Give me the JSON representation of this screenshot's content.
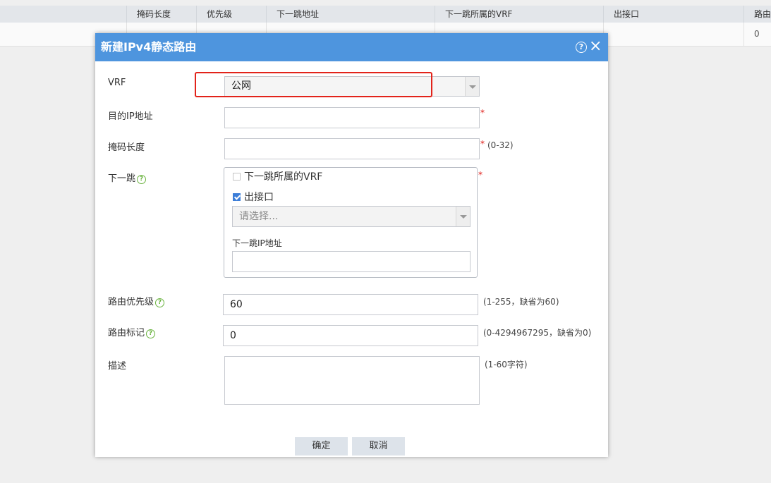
{
  "table": {
    "headers": [
      "掩码长度",
      "优先级",
      "下一跳地址",
      "下一跳所属的VRF",
      "出接口",
      "路由"
    ],
    "row": [
      "0"
    ]
  },
  "dialog": {
    "title": "新建IPv4静态路由",
    "help_icon": "?",
    "close_icon": "×",
    "vrf": {
      "label": "VRF",
      "value": "公网"
    },
    "dest_ip": {
      "label": "目的IP地址",
      "value": "",
      "required": "*"
    },
    "mask": {
      "label": "掩码长度",
      "value": "",
      "required": "*",
      "hint": "(0-32)"
    },
    "next_hop": {
      "label": "下一跳",
      "required": "*",
      "vrf_checkbox": {
        "label": "下一跳所属的VRF",
        "checked": false
      },
      "iface_checkbox": {
        "label": "出接口",
        "checked": true
      },
      "iface_select": {
        "placeholder": "请选择..."
      },
      "ip": {
        "label": "下一跳IP地址",
        "value": ""
      }
    },
    "priority": {
      "label": "路由优先级",
      "value": "60",
      "hint": "(1-255，缺省为60)"
    },
    "tag": {
      "label": "路由标记",
      "value": "0",
      "hint": "(0-4294967295，缺省为0)"
    },
    "desc": {
      "label": "描述",
      "value": "",
      "hint": "(1-60字符)"
    },
    "ok_label": "确定",
    "cancel_label": "取消"
  },
  "colors": {
    "header_blue": "#4e95de",
    "highlight_red": "#e2231a",
    "required_red": "#e0201b",
    "help_green": "#6ab33f",
    "checkbox_blue": "#3d7ed8"
  }
}
